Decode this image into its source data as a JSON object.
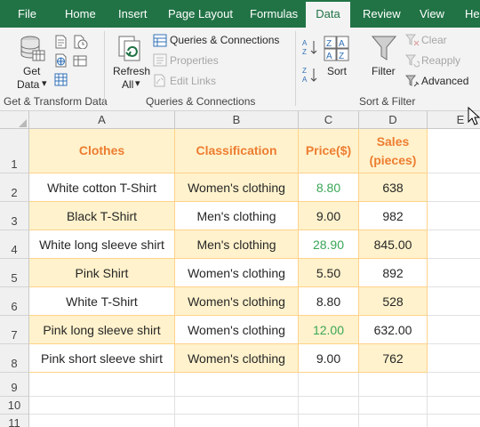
{
  "ribbon_tabs": [
    "File",
    "Home",
    "Insert",
    "Page Layout",
    "Formulas",
    "Data",
    "Review",
    "View",
    "He"
  ],
  "active_tab": "Data",
  "groups": {
    "get_transform": {
      "label": "Get & Transform Data",
      "get_data_line1": "Get",
      "get_data_line2": "Data",
      "dropdown_glyph": "▾"
    },
    "queries": {
      "label": "Queries & Connections",
      "refresh_line1": "Refresh",
      "refresh_line2": "All",
      "dropdown_glyph": "▾",
      "queries_connections": "Queries & Connections",
      "properties": "Properties",
      "edit_links": "Edit Links"
    },
    "sort_filter": {
      "label": "Sort & Filter",
      "sort": "Sort",
      "filter": "Filter",
      "clear": "Clear",
      "reapply": "Reapply",
      "advanced": "Advanced"
    }
  },
  "columns": [
    "A",
    "B",
    "C",
    "D",
    "E"
  ],
  "rows": [
    "1",
    "2",
    "3",
    "4",
    "5",
    "6",
    "7",
    "8",
    "9",
    "10",
    "11"
  ],
  "table": {
    "headers": [
      "Clothes",
      "Classification",
      "Price($)",
      "Sales\n(pieces)"
    ],
    "data": [
      [
        "White cotton T-Shirt",
        "Women's clothing",
        "8.80",
        "638"
      ],
      [
        "Black T-Shirt",
        "Men's clothing",
        "9.00",
        "982"
      ],
      [
        "White long sleeve shirt",
        "Men's clothing",
        "28.90",
        "845.00"
      ],
      [
        "Pink Shirt",
        "Women's clothing",
        "5.50",
        "892"
      ],
      [
        "White T-Shirt",
        "Women's clothing",
        "8.80",
        "528"
      ],
      [
        "Pink long sleeve shirt",
        "Women's clothing",
        "12.00",
        "632.00"
      ],
      [
        "Pink short sleeve shirt",
        "Women's clothing",
        "9.00",
        "762"
      ]
    ]
  },
  "colors": {
    "ribbon_green": "#217346",
    "header_orange": "#ed7d31",
    "cell_fill": "#fff2cc",
    "green_value": "#3aa657",
    "cell_border": "#ffd28a"
  },
  "icons": [
    "database-icon",
    "from-text-icon",
    "from-web-icon",
    "from-table-icon",
    "recent-sources-icon",
    "existing-connections-icon",
    "refresh-icon",
    "queries-connections-icon",
    "properties-icon",
    "edit-links-icon",
    "sort-asc-icon",
    "sort-desc-icon",
    "sort-icon",
    "filter-icon",
    "clear-icon",
    "reapply-icon",
    "advanced-icon",
    "mouse-cursor-icon"
  ]
}
